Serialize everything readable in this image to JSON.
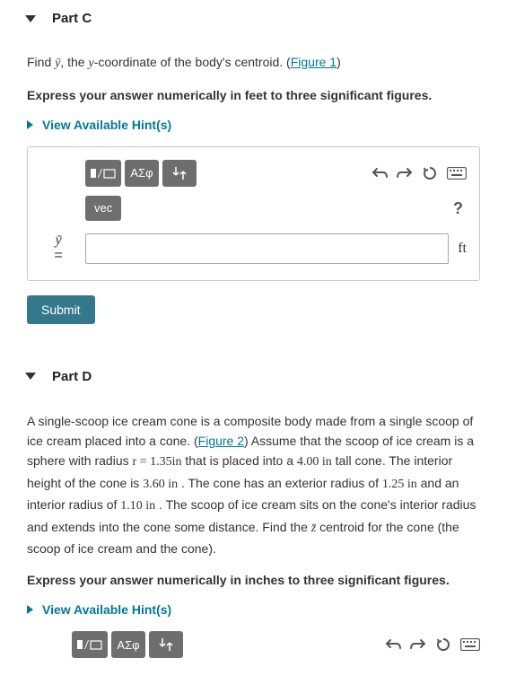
{
  "partC": {
    "header": "Part C",
    "prompt_pre": "Find ",
    "prompt_var": "ȳ",
    "prompt_mid": ", the ",
    "prompt_yword": "y",
    "prompt_post": "-coordinate of the body's centroid. (",
    "figure_link": "Figure 1",
    "prompt_close": ")",
    "express": "Express your answer numerically in feet to three significant figures.",
    "hints": "View Available Hint(s)",
    "toolbar": {
      "templates": "▮√▭",
      "greek": "ΑΣφ",
      "updown": "↓↑",
      "vec": "vec",
      "help": "?"
    },
    "var_label": "ȳ",
    "eq": "=",
    "unit": "ft",
    "submit": "Submit"
  },
  "partD": {
    "header": "Part D",
    "text_a": "A single-scoop ice cream cone is a composite body made from a single scoop of ice cream placed into a cone. (",
    "figure_link": "Figure 2",
    "text_b": ") Assume that the scoop of ice cream is a sphere with radius ",
    "r_eq": "r = 1.35in",
    "text_c": " that is placed into a ",
    "val_h": "4.00 in",
    "text_d": " tall cone. The interior height of the cone is ",
    "val_ih": "3.60 in",
    "text_e": " . The cone has an exterior radius of ",
    "val_er": "1.25 in",
    "text_f": " and an interior radius of ",
    "val_ir": "1.10 in",
    "text_g": " . The scoop of ice cream sits on the cone's interior radius and extends into the cone some distance. Find the ",
    "zbar": "z̄",
    "text_h": " centroid for the cone (the scoop of ice cream and the cone).",
    "express": "Express your answer numerically in inches to three significant figures.",
    "hints": "View Available Hint(s)",
    "toolbar": {
      "templates": "▮√▭",
      "greek": "ΑΣφ",
      "updown": "↓↑"
    }
  }
}
